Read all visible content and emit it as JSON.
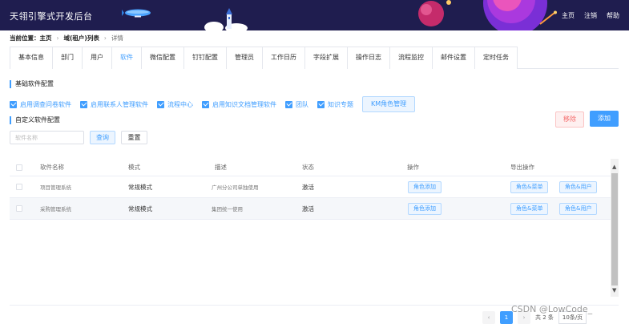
{
  "header": {
    "title": "天翎引擎式开发后台",
    "nav": [
      "主页",
      "注销",
      "帮助"
    ]
  },
  "breadcrumb": {
    "prefix": "当前位置：",
    "items": [
      "主页",
      "域(租户)列表",
      "详情"
    ]
  },
  "tabs": [
    "基本信息",
    "部门",
    "用户",
    "软件",
    "微信配置",
    "钉钉配置",
    "管理员",
    "工作日历",
    "字段扩展",
    "操作日志",
    "流程监控",
    "邮件设置",
    "定时任务"
  ],
  "active_tab": "软件",
  "basic_section": {
    "title": "基础软件配置",
    "checks": [
      "启用调查问卷软件",
      "启用联系人管理软件",
      "流程中心",
      "启用知识文档管理软件",
      "团队",
      "知识专题"
    ],
    "km_button": "KM角色管理"
  },
  "custom_section": {
    "title": "自定义软件配置",
    "remove_label": "移除",
    "add_label": "添加",
    "search_placeholder": "软件名称",
    "query_label": "查询",
    "reset_label": "重置"
  },
  "table": {
    "headers": [
      "软件名称",
      "模式",
      "描述",
      "状态",
      "操作",
      "导出操作"
    ],
    "rows": [
      {
        "name": "项目管理系统",
        "mode": "常规模式",
        "desc": "广州分公司单独使用",
        "status": "激活",
        "op": "角色添加",
        "export1": "角色&菜单",
        "export2": "角色&用户"
      },
      {
        "name": "采购管理系统",
        "mode": "常规模式",
        "desc": "集团统一使用",
        "status": "激活",
        "op": "角色添加",
        "export1": "角色&菜单",
        "export2": "角色&用户"
      }
    ]
  },
  "pager": {
    "current": "1",
    "total": "共 2 条",
    "size": "10条/页"
  },
  "watermark": "CSDN @LowCode_",
  "colors": {
    "primary": "#409eff",
    "header_bg": "#1f1d4f",
    "danger": "#f56c6c"
  }
}
